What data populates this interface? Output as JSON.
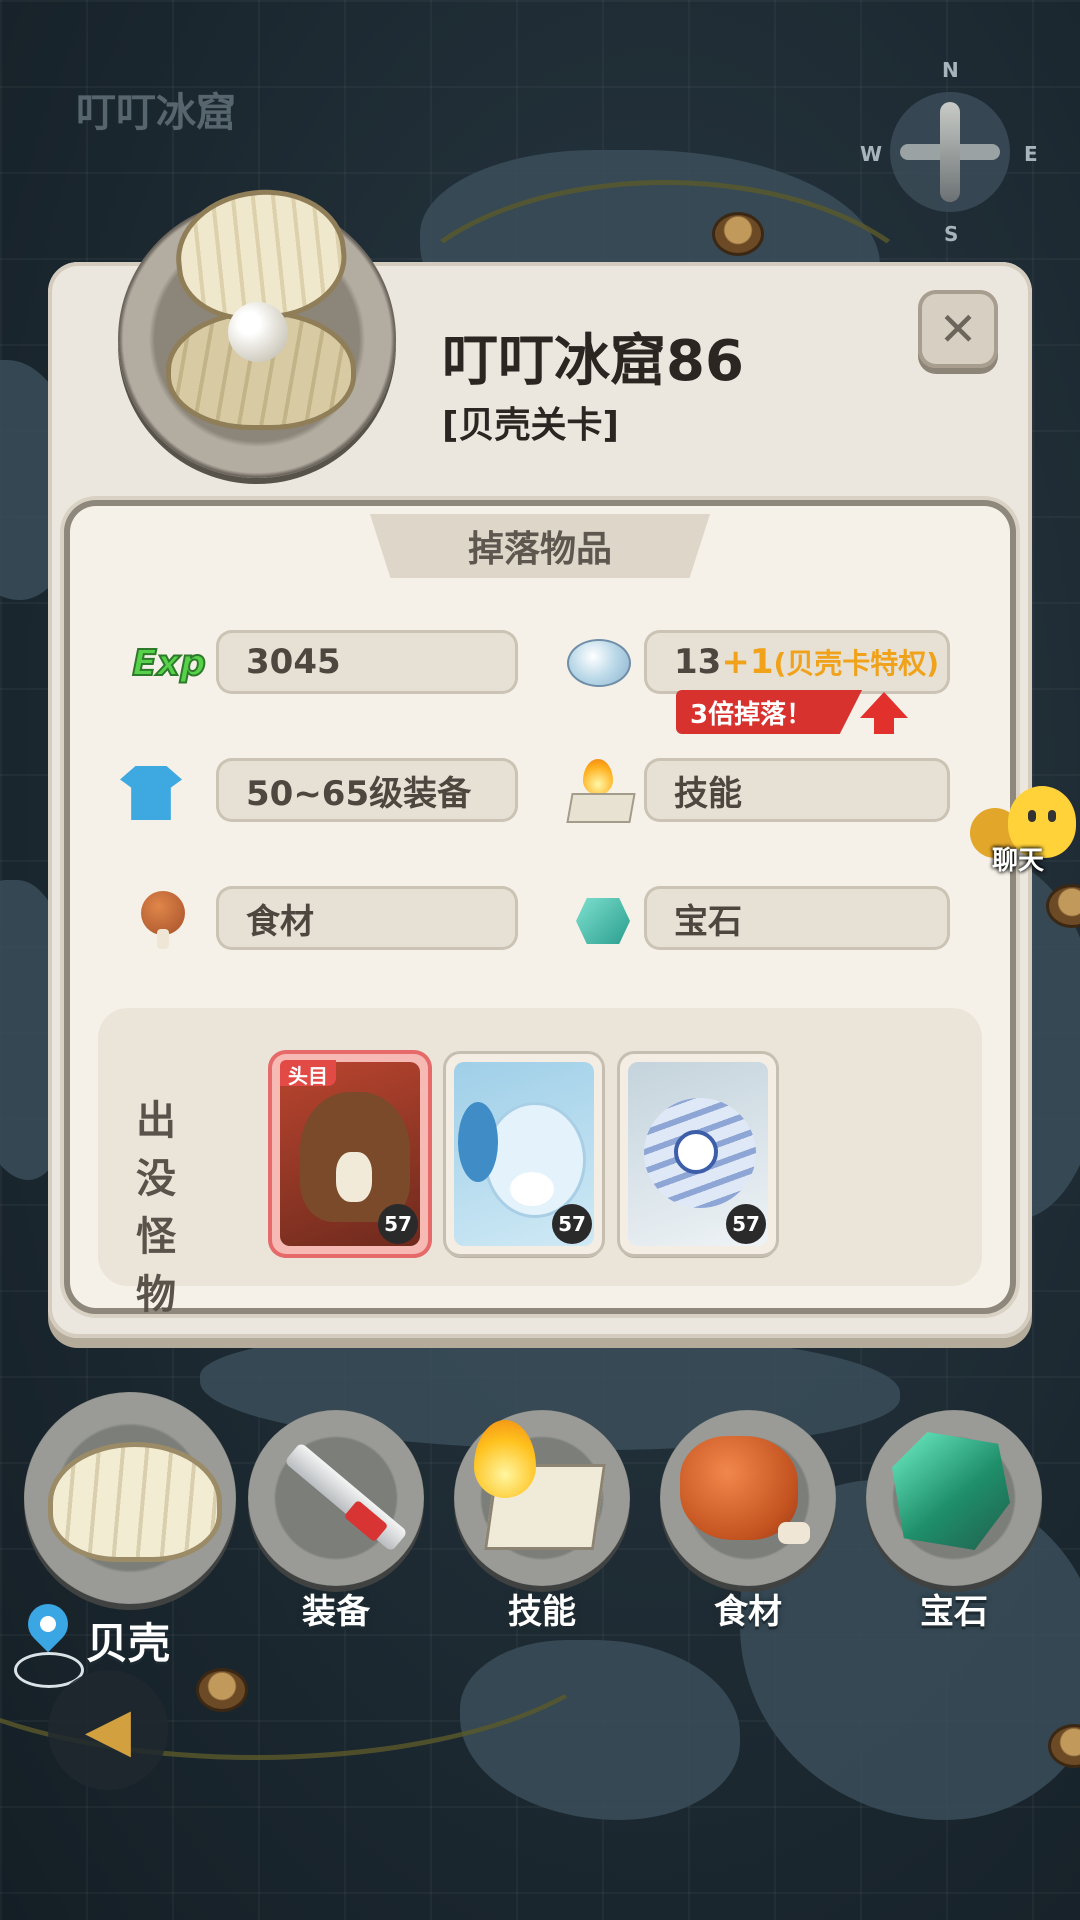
{
  "map": {
    "title": "叮叮冰窟"
  },
  "compass": {
    "n": "N",
    "s": "S",
    "e": "E",
    "w": "W"
  },
  "panel": {
    "title": "叮叮冰窟86",
    "subtitle": "[贝壳关卡]",
    "close_icon": "close-icon",
    "drops_tab": "掉落物品",
    "drops": {
      "exp": {
        "icon": "exp-icon",
        "icon_text": "Exp",
        "value": "3045"
      },
      "shell": {
        "icon": "shell-icon",
        "base": "13",
        "plus": "+1",
        "privilege": "(贝壳卡特权)",
        "badge": "3倍掉落！"
      },
      "equipment": {
        "icon": "shirt-icon",
        "value": "50~65级装备"
      },
      "skill": {
        "icon": "flame-icon",
        "value": "技能"
      },
      "food": {
        "icon": "meat-icon",
        "value": "食材"
      },
      "gem": {
        "icon": "gem-icon",
        "value": "宝石"
      }
    },
    "monsters": {
      "label": "出没怪物",
      "list": [
        {
          "name": "boss-mammoth",
          "boss_tag": "头目",
          "level": "57"
        },
        {
          "name": "ram",
          "level": "57"
        },
        {
          "name": "pufferfish",
          "level": "57"
        }
      ]
    }
  },
  "chat": {
    "label": "聊天"
  },
  "bottom_nav": {
    "current": "贝壳",
    "items": [
      {
        "label": "装备",
        "icon": "sword-icon"
      },
      {
        "label": "技能",
        "icon": "flame-scroll-icon"
      },
      {
        "label": "食材",
        "icon": "meat-icon"
      },
      {
        "label": "宝石",
        "icon": "gem-icon"
      }
    ]
  },
  "colors": {
    "accent_red": "#d8322f",
    "accent_orange": "#f0a21a",
    "pin_blue": "#3aa6e4"
  }
}
